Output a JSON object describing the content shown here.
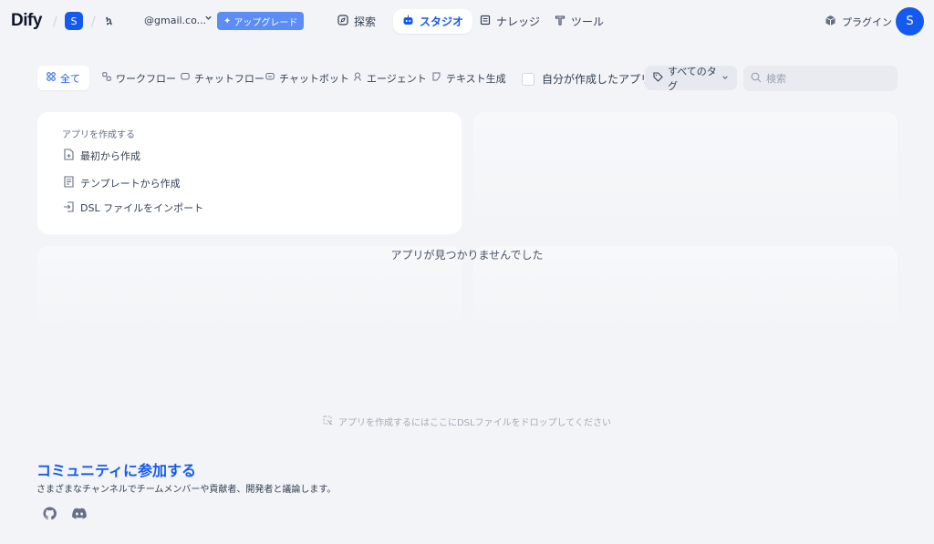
{
  "header": {
    "logo_text": "Dify",
    "workspace_initial": "S",
    "workspace_icon_text": "ኳ",
    "email": "@gmail.co...",
    "upgrade_label": "アップグレード",
    "nav": [
      {
        "label": "探索"
      },
      {
        "label": "スタジオ"
      },
      {
        "label": "ナレッジ"
      },
      {
        "label": "ツール"
      }
    ],
    "plugin_label": "プラグイン",
    "avatar_initial": "S"
  },
  "filters": {
    "tabs": [
      {
        "label": "全て"
      },
      {
        "label": "ワークフロー"
      },
      {
        "label": "チャットフロー"
      },
      {
        "label": "チャットボット"
      },
      {
        "label": "エージェント"
      },
      {
        "label": "テキスト生成"
      }
    ],
    "created_by_me_label": "自分が作成したアプリ",
    "tag_label": "すべてのタグ",
    "search_placeholder": "検索"
  },
  "create_card": {
    "title": "アプリを作成する",
    "items": [
      {
        "label": "最初から作成"
      },
      {
        "label": "テンプレートから作成"
      },
      {
        "label": "DSL ファイルをインポート"
      }
    ]
  },
  "empty_message": "アプリが見つかりませんでした",
  "drop_hint": "アプリを作成するにはここにDSLファイルをドロップしてください",
  "community": {
    "title": "コミュニティに参加する",
    "description": "さまざまなチャンネルでチームメンバーや貢献者、開発者と議論します。"
  }
}
